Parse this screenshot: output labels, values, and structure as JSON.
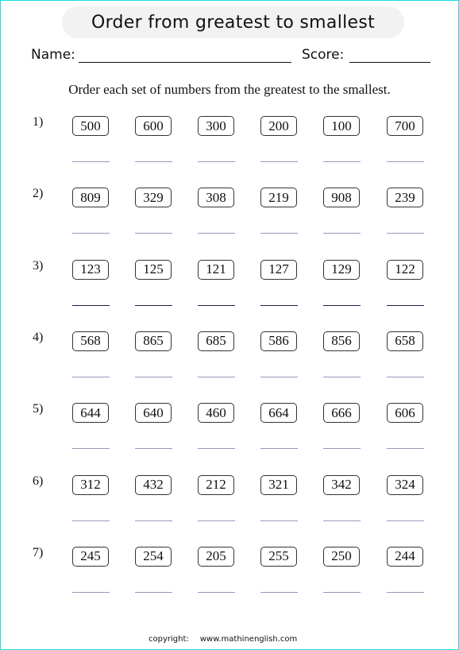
{
  "title": "Order from greatest to smallest",
  "name_label": "Name:",
  "score_label": "Score:",
  "instructions": "Order each set of numbers from the greatest to the smallest.",
  "problems": [
    {
      "label": "1)",
      "numbers": [
        "500",
        "600",
        "300",
        "200",
        "100",
        "700"
      ],
      "answers": [
        "",
        "",
        "",
        "",
        "",
        ""
      ]
    },
    {
      "label": "2)",
      "numbers": [
        "809",
        "329",
        "308",
        "219",
        "908",
        "239"
      ],
      "answers": [
        "",
        "",
        "",
        "",
        "",
        ""
      ]
    },
    {
      "label": "3)",
      "numbers": [
        "123",
        "125",
        "121",
        "127",
        "129",
        "122"
      ],
      "answers": [
        "",
        "",
        "",
        "",
        "",
        ""
      ]
    },
    {
      "label": "4)",
      "numbers": [
        "568",
        "865",
        "685",
        "586",
        "856",
        "658"
      ],
      "answers": [
        "",
        "",
        "",
        "",
        "",
        ""
      ]
    },
    {
      "label": "5)",
      "numbers": [
        "644",
        "640",
        "460",
        "664",
        "666",
        "606"
      ],
      "answers": [
        "",
        "",
        "",
        "",
        "",
        ""
      ]
    },
    {
      "label": "6)",
      "numbers": [
        "312",
        "432",
        "212",
        "321",
        "342",
        "324"
      ],
      "answers": [
        "",
        "",
        "",
        "",
        "",
        ""
      ]
    },
    {
      "label": "7)",
      "numbers": [
        "245",
        "254",
        "205",
        "255",
        "250",
        "244"
      ],
      "answers": [
        "",
        "",
        "",
        "",
        "",
        ""
      ]
    }
  ],
  "footer": {
    "copyright_label": "copyright:",
    "url": "www.mathinenglish.com"
  },
  "colors": {
    "border": "#16e0e6",
    "title_fill": "#f2f2f2",
    "answer_line": "#9a98bd",
    "answer_line_dark": "#1c1b4a"
  }
}
